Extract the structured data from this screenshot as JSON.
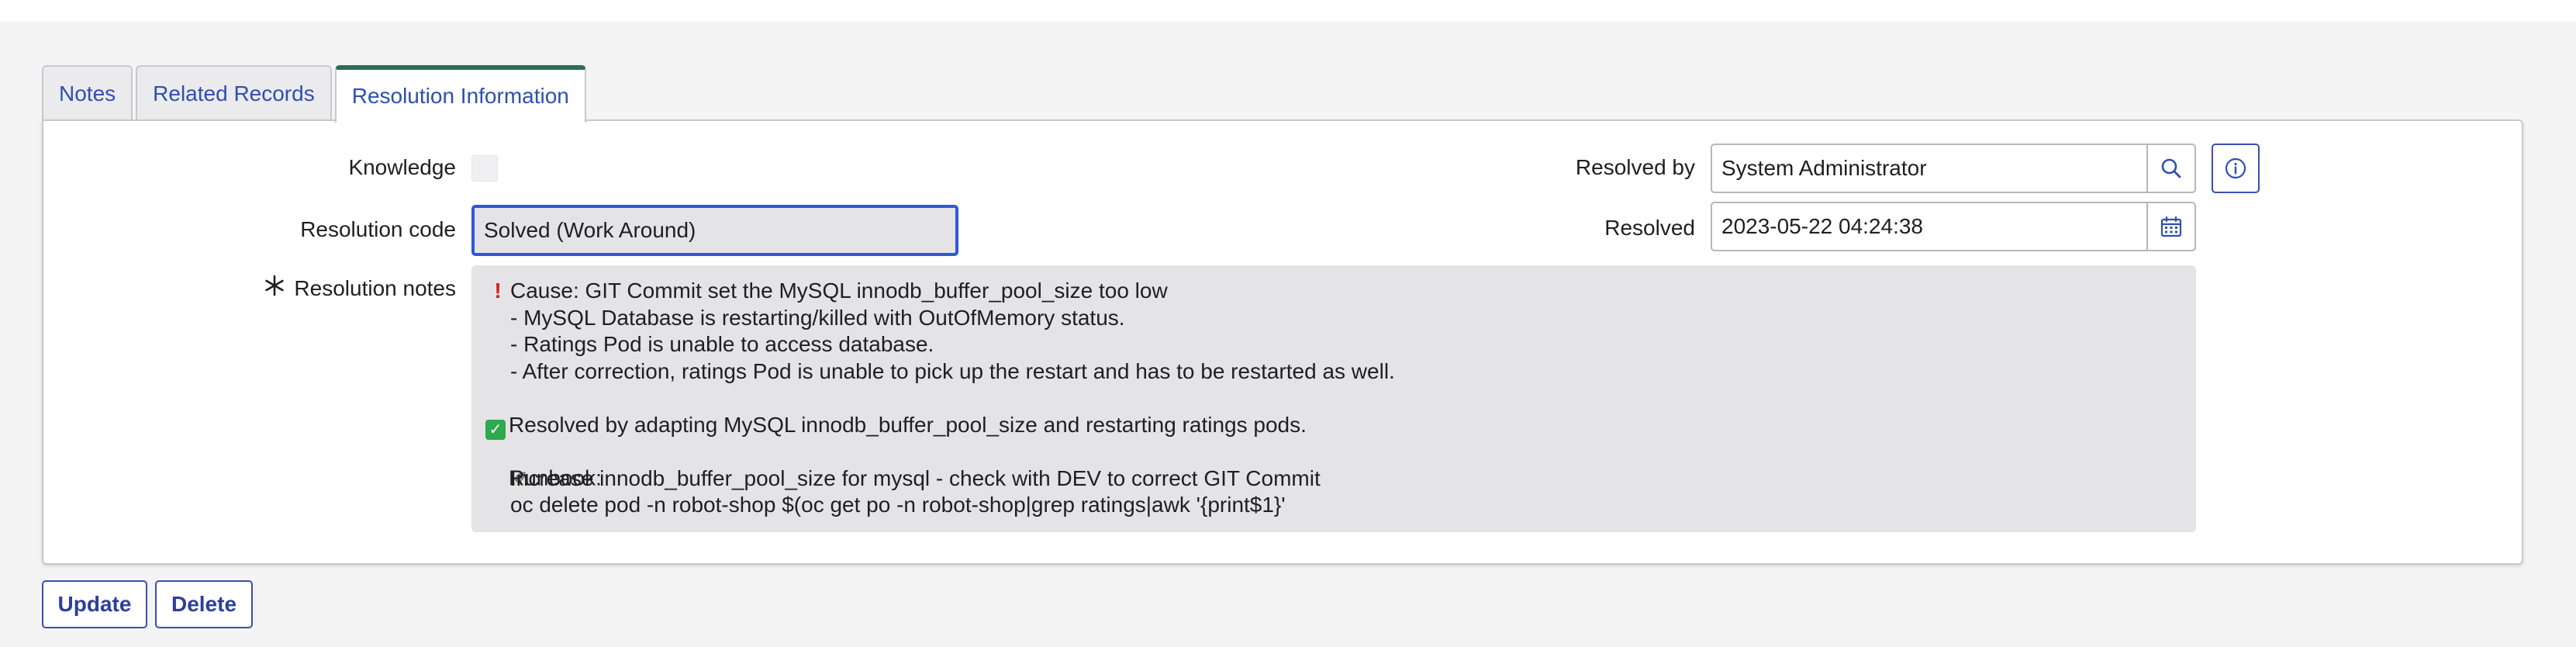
{
  "tabs": [
    {
      "label": "Notes",
      "active": false
    },
    {
      "label": "Related Records",
      "active": false
    },
    {
      "label": "Resolution Information",
      "active": true
    }
  ],
  "form": {
    "knowledge_label": "Knowledge",
    "knowledge_checked": false,
    "resolution_code_label": "Resolution code",
    "resolution_code_value": "Solved (Work Around)",
    "resolution_notes_label": "Resolution notes",
    "resolution_notes_required": true,
    "resolution_notes": {
      "lines": [
        "Cause: GIT Commit set the MySQL innodb_buffer_pool_size too low",
        "- MySQL Database is restarting/killed with OutOfMemory status.",
        "- Ratings Pod is unable to access database.",
        "- After correction, ratings Pod is unable to pick up the restart and has to be restarted as well.",
        "Resolved by adapting MySQL innodb_buffer_pool_size and restarting ratings pods.",
        "Runbook:",
        "Increase innodb_buffer_pool_size for mysql - check with DEV to correct GIT Commit",
        "oc delete pod -n robot-shop $(oc get po -n robot-shop|grep ratings|awk '{print$1}'"
      ]
    },
    "resolved_by_label": "Resolved by",
    "resolved_by_value": "System Administrator",
    "resolved_label": "Resolved",
    "resolved_value": "2023-05-22 04:24:38"
  },
  "actions": {
    "update_label": "Update",
    "delete_label": "Delete"
  },
  "icons": {
    "resolved_by_lookup": "search-icon",
    "resolved_by_info": "info-icon",
    "resolved_calendar": "calendar-icon",
    "required": "asterisk-icon",
    "cause_marker": "exclamation-icon",
    "resolved_marker": "check-mark-icon",
    "runbook_marker": "rocket-icon"
  },
  "colors": {
    "accent": "#3157d6",
    "link": "#2d4fb0",
    "active_tab_bar": "#2e6b5a",
    "button_border": "#3b4fb0"
  }
}
